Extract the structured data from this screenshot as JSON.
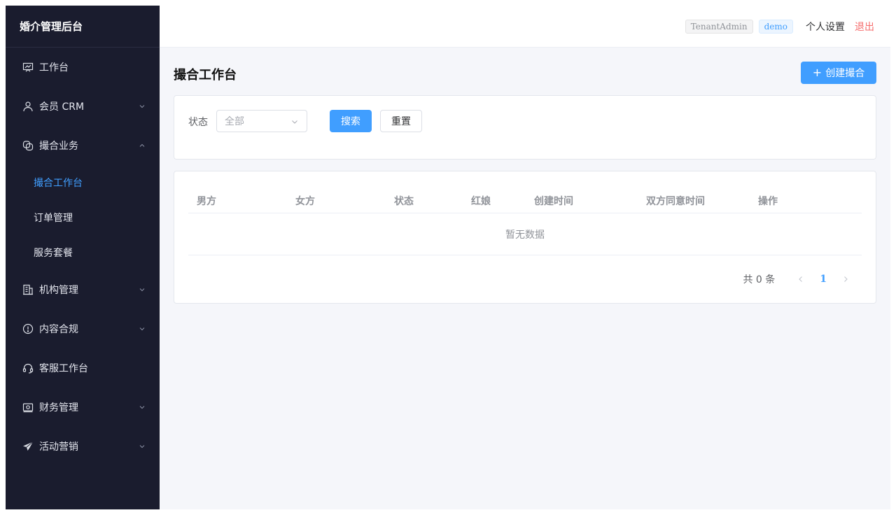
{
  "sidebar": {
    "brand": "婚介管理后台",
    "items": [
      {
        "label": "工作台",
        "icon": "presentation-chart-icon",
        "arrow": ""
      },
      {
        "label": "会员 CRM",
        "icon": "user-icon",
        "arrow": "down"
      },
      {
        "label": "撮合业务",
        "icon": "link-icon",
        "arrow": "up"
      },
      {
        "label": "机构管理",
        "icon": "building-icon",
        "arrow": "down"
      },
      {
        "label": "内容合规",
        "icon": "warning-circle-icon",
        "arrow": "down"
      },
      {
        "label": "客服工作台",
        "icon": "headset-icon",
        "arrow": ""
      },
      {
        "label": "财务管理",
        "icon": "wallet-icon",
        "arrow": "down"
      },
      {
        "label": "活动营销",
        "icon": "paper-plane-icon",
        "arrow": "down"
      }
    ],
    "submenu": [
      {
        "label": "撮合工作台",
        "active": true
      },
      {
        "label": "订单管理",
        "active": false
      },
      {
        "label": "服务套餐",
        "active": false
      }
    ]
  },
  "topbar": {
    "role_tag": "TenantAdmin",
    "tenant_tag": "demo",
    "settings": "个人设置",
    "logout": "退出"
  },
  "page": {
    "title": "撮合工作台",
    "create_button": "创建撮合",
    "create_icon": "plus-icon"
  },
  "filter": {
    "status_label": "状态",
    "status_value": "全部",
    "search_button": "搜索",
    "reset_button": "重置"
  },
  "table": {
    "columns": [
      "男方",
      "女方",
      "状态",
      "红娘",
      "创建时间",
      "双方同意时间",
      "操作"
    ],
    "empty_text": "暂无数据"
  },
  "pagination": {
    "total": "共 0 条",
    "current_page": "1"
  },
  "colors": {
    "sidebar_bg": "#1a1c2e",
    "primary": "#409eff",
    "danger": "#f56c6c",
    "page_bg": "#f5f6fa"
  }
}
